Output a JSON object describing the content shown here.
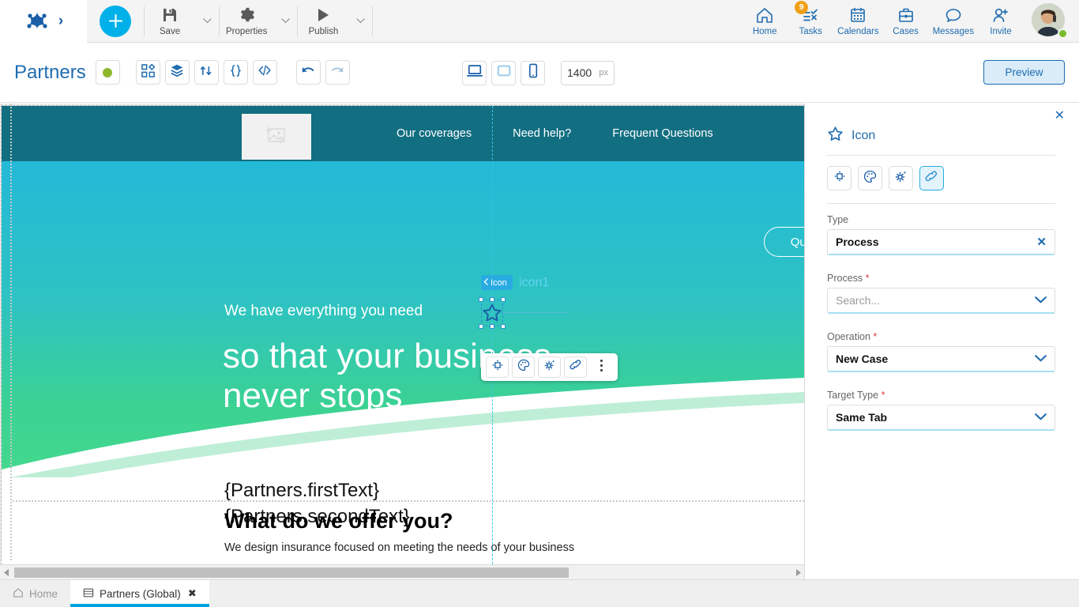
{
  "topbar": {
    "logo_icon": "bizagi-logo-icon",
    "expand_icon": "chevron-right-icon",
    "add_label": "+",
    "tools": [
      {
        "icon": "save-icon",
        "label": "Save"
      },
      {
        "icon": "properties-icon",
        "label": "Properties"
      },
      {
        "icon": "publish-icon",
        "label": "Publish"
      }
    ],
    "nav": [
      {
        "icon": "home-icon",
        "label": "Home",
        "badge": ""
      },
      {
        "icon": "tasks-icon",
        "label": "Tasks",
        "badge": "9"
      },
      {
        "icon": "calendars-icon",
        "label": "Calendars",
        "badge": ""
      },
      {
        "icon": "cases-icon",
        "label": "Cases",
        "badge": ""
      },
      {
        "icon": "messages-icon",
        "label": "Messages",
        "badge": ""
      },
      {
        "icon": "invite-icon",
        "label": "Invite",
        "badge": ""
      }
    ],
    "avatar_name": "user-avatar",
    "presence_color": "#77bb2a"
  },
  "secondbar": {
    "title": "Partners",
    "status_dot_color": "#8eb82c",
    "buttons": [
      {
        "icon": "widgets-icon"
      },
      {
        "icon": "layers-icon"
      },
      {
        "icon": "workflow-icon"
      },
      {
        "icon": "braces-icon"
      },
      {
        "icon": "code-icon"
      }
    ],
    "undo_icon": "undo-icon",
    "redo_icon": "redo-icon",
    "devices": [
      {
        "icon": "desktop-icon",
        "active": true
      },
      {
        "icon": "tablet-icon",
        "active": false
      },
      {
        "icon": "mobile-icon",
        "active": false
      }
    ],
    "width_value": "1400",
    "width_unit": "px",
    "preview_label": "Preview"
  },
  "canvas": {
    "site_logo_placeholder_icon": "image-placeholder-icon",
    "nav_links": [
      "Our coverages",
      "Need help?",
      "Frequent Questions"
    ],
    "pill_button_label": "Quote now",
    "hero_subtitle": "We have everything you need",
    "hero_title_line1": "so that your business",
    "hero_title_line2": "never stops",
    "template_line1": "{Partners.firstText}",
    "template_line2": "{Partners.secondText}",
    "offer_heading": "What do we offer you?",
    "offer_paragraph": "We design insurance focused on meeting the needs of your business",
    "selected_element": {
      "tag_label": "Icon",
      "tag_back_icon": "chevron-left-icon",
      "ghost_label": "icon1",
      "shape_icon": "star-outline-icon"
    },
    "float_toolbar": [
      {
        "icon": "move-icon"
      },
      {
        "icon": "palette-icon"
      },
      {
        "icon": "settings-sparkle-icon"
      },
      {
        "icon": "link-icon"
      },
      {
        "icon": "more-vertical-icon"
      }
    ]
  },
  "panel": {
    "close_icon": "close-icon",
    "header_icon": "star-outline-icon",
    "header_title": "Icon",
    "tabs": [
      {
        "icon": "move-icon",
        "active": false
      },
      {
        "icon": "palette-icon",
        "active": false
      },
      {
        "icon": "settings-sparkle-icon",
        "active": false
      },
      {
        "icon": "link-icon",
        "active": true
      }
    ],
    "fields": [
      {
        "label": "Type",
        "required": false,
        "value": "Process",
        "placeholder": "",
        "control": "clear"
      },
      {
        "label": "Process",
        "required": true,
        "value": "",
        "placeholder": "Search...",
        "control": "select"
      },
      {
        "label": "Operation",
        "required": true,
        "value": "New Case",
        "placeholder": "",
        "control": "select"
      },
      {
        "label": "Target Type",
        "required": true,
        "value": "Same Tab",
        "placeholder": "",
        "control": "select"
      }
    ]
  },
  "bottom_tabs": [
    {
      "icon": "home-outline-icon",
      "label": "Home",
      "active": false,
      "closable": false
    },
    {
      "icon": "page-icon",
      "label": "Partners (Global)",
      "active": true,
      "closable": true
    }
  ],
  "colors": {
    "accent_blue": "#1f6cb0",
    "cyan": "#00b0e8",
    "site_header": "#126e81",
    "hero_top": "#23b9d8",
    "hero_bottom": "#45d98e",
    "badge_orange": "#f0a018"
  }
}
